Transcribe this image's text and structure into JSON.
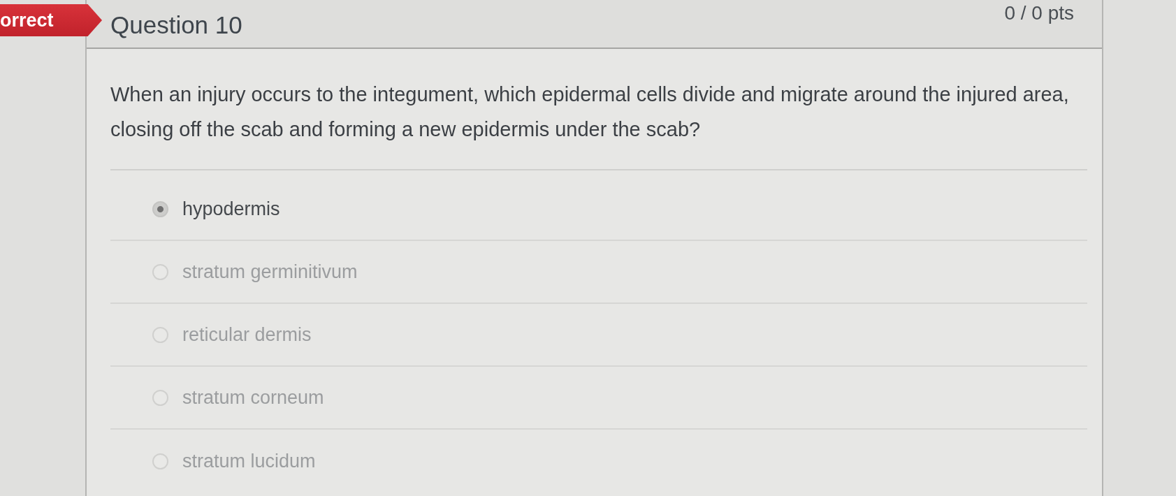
{
  "badge": {
    "label": "orrect"
  },
  "question": {
    "title": "Question 10",
    "points": "0 / 0 pts",
    "text": "When an injury occurs to the integument, which epidermal cells divide and migrate around the injured area, closing off the scab and forming a new epidermis under the scab?"
  },
  "answers": [
    {
      "label": "hypodermis",
      "selected": true
    },
    {
      "label": "stratum germinitivum",
      "selected": false
    },
    {
      "label": "reticular dermis",
      "selected": false
    },
    {
      "label": "stratum corneum",
      "selected": false
    },
    {
      "label": "stratum lucidum",
      "selected": false
    }
  ]
}
